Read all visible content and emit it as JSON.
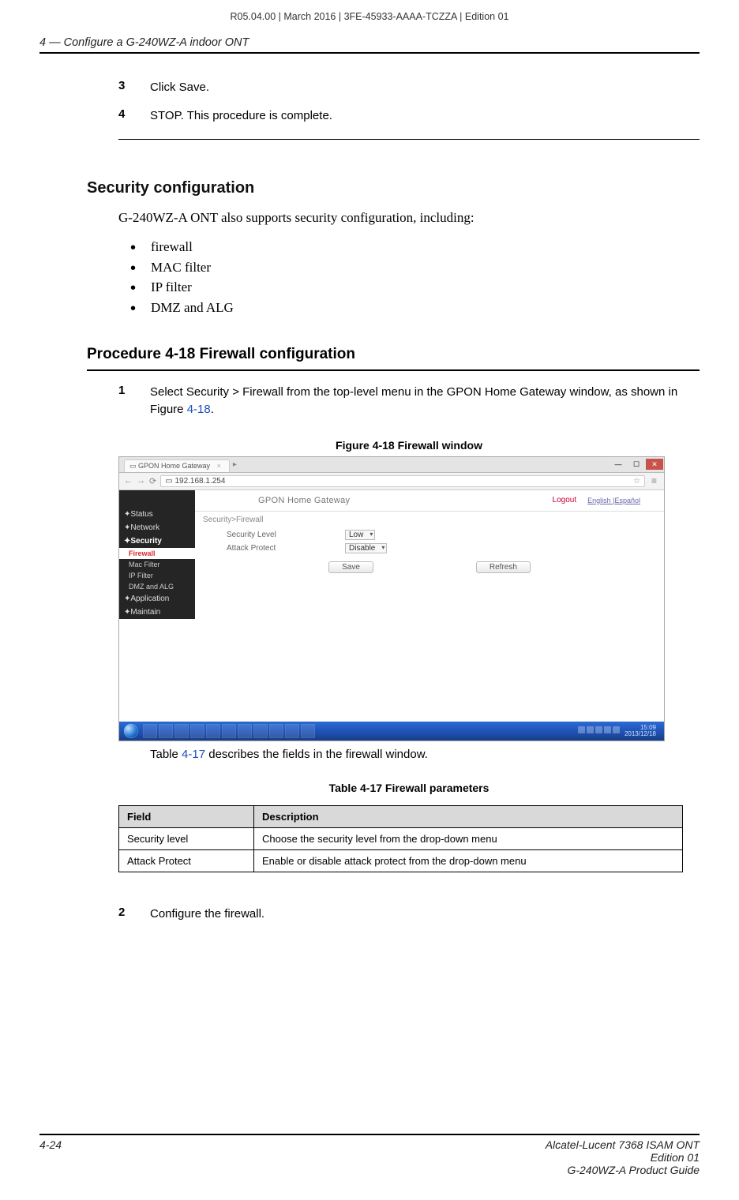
{
  "doc_meta": "R05.04.00 | March 2016 | 3FE-45933-AAAA-TCZZA | Edition 01",
  "chapter_header": "4 —  Configure a G-240WZ-A indoor ONT",
  "steps_top": [
    {
      "num": "3",
      "text": "Click Save."
    },
    {
      "num": "4",
      "text": "STOP. This procedure is complete."
    }
  ],
  "section_title": "Security configuration",
  "section_intro": "G-240WZ-A ONT also supports security configuration, including:",
  "bullets": [
    "firewall",
    "MAC filter",
    "IP filter",
    "DMZ and ALG"
  ],
  "procedure_title": "Procedure 4-18  Firewall configuration",
  "procedure_step1": {
    "num": "1",
    "prefix": "Select Security > Firewall from the top-level menu in the GPON Home Gateway window, as shown in Figure ",
    "link": "4-18",
    "suffix": "."
  },
  "figure_caption": "Figure 4-18  Firewall window",
  "screenshot": {
    "tab_title": "GPON Home Gateway",
    "url": "192.168.1.254",
    "app_title": "GPON Home Gateway",
    "logout": "Logout",
    "lang": "English |Español",
    "crumb": "Security>Firewall",
    "sidebar": {
      "items": [
        "Status",
        "Network",
        "Security"
      ],
      "subs": [
        "Firewall",
        "Mac Filter",
        "IP Filter",
        "DMZ and ALG"
      ],
      "items_after": [
        "Application",
        "Maintain"
      ]
    },
    "form": {
      "row1_label": "Security Level",
      "row1_value": "Low",
      "row2_label": "Attack Protect",
      "row2_value": "Disable"
    },
    "buttons": {
      "save": "Save",
      "refresh": "Refresh"
    },
    "tray_time": "15:09",
    "tray_date": "2013/12/18"
  },
  "post_figure_text": {
    "prefix": "Table ",
    "link": "4-17",
    "suffix": " describes the fields in the firewall window."
  },
  "table_caption": "Table 4-17 Firewall parameters",
  "table": {
    "headers": [
      "Field",
      "Description"
    ],
    "rows": [
      [
        "Security level",
        "Choose the security level from the drop-down menu"
      ],
      [
        "Attack Protect",
        "Enable or disable attack protect from the drop-down menu"
      ]
    ]
  },
  "procedure_step2": {
    "num": "2",
    "text": "Configure the firewall."
  },
  "footer": {
    "left": "4-24",
    "right1": "Alcatel-Lucent 7368 ISAM ONT",
    "right2": "Edition 01",
    "right3": "G-240WZ-A Product Guide"
  }
}
